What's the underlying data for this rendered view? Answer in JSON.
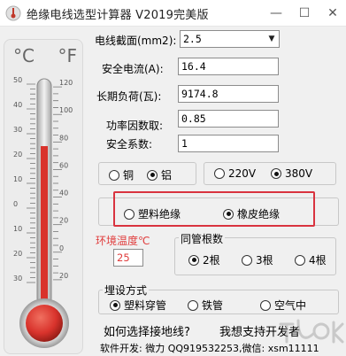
{
  "window": {
    "title": "绝缘电线选型计算器 V2019完美版",
    "minimize_glyph": "—",
    "maximize_glyph": "☐",
    "close_glyph": "✕"
  },
  "thermometer": {
    "celsius_symbol": "°C",
    "fahrenheit_symbol": "°F",
    "celsius_ticks": [
      "50",
      "40",
      "30",
      "20",
      "10",
      "0",
      "10",
      "20",
      "30"
    ],
    "fahrenheit_ticks": [
      "120",
      "100",
      "80",
      "60",
      "40",
      "20",
      "0",
      "20"
    ],
    "mercury_color": "#d9332c",
    "level_celsius": 25
  },
  "form": {
    "cross_section_label": "电线截面(mm2):",
    "cross_section_value": "2.5",
    "safe_current_label": "安全电流(A):",
    "safe_current_value": "16.4",
    "long_term_load_label": "长期负荷(瓦):",
    "long_term_load_value": "9174.8",
    "power_factor_label": "功率因数取:",
    "power_factor_value": "0.85",
    "safety_factor_label": "安全系数:",
    "safety_factor_value": "1"
  },
  "material": {
    "copper_label": "铜",
    "aluminum_label": "铝",
    "selected": "aluminum"
  },
  "voltage": {
    "v220_label": "220V",
    "v380_label": "380V",
    "selected": "380V"
  },
  "insulation": {
    "plastic_label": "塑料绝缘",
    "rubber_label": "橡皮绝缘",
    "selected": "rubber",
    "highlight_color": "#d9333f"
  },
  "ambient": {
    "label": "环境温度℃",
    "value": "25",
    "color": "#e03c3c"
  },
  "conduit": {
    "title": "同管根数",
    "options": [
      "2根",
      "3根",
      "4根"
    ],
    "selected": "2根"
  },
  "laying": {
    "title": "埋设方式",
    "options": [
      "塑料穿管",
      "铁管",
      "空气中"
    ],
    "selected": "塑料穿管"
  },
  "links": {
    "grounding": "如何选择接地线?",
    "support": "我想支持开发者"
  },
  "footer": {
    "text": "软件开发: 微力 QQ919532253,微信: xsm11111"
  }
}
